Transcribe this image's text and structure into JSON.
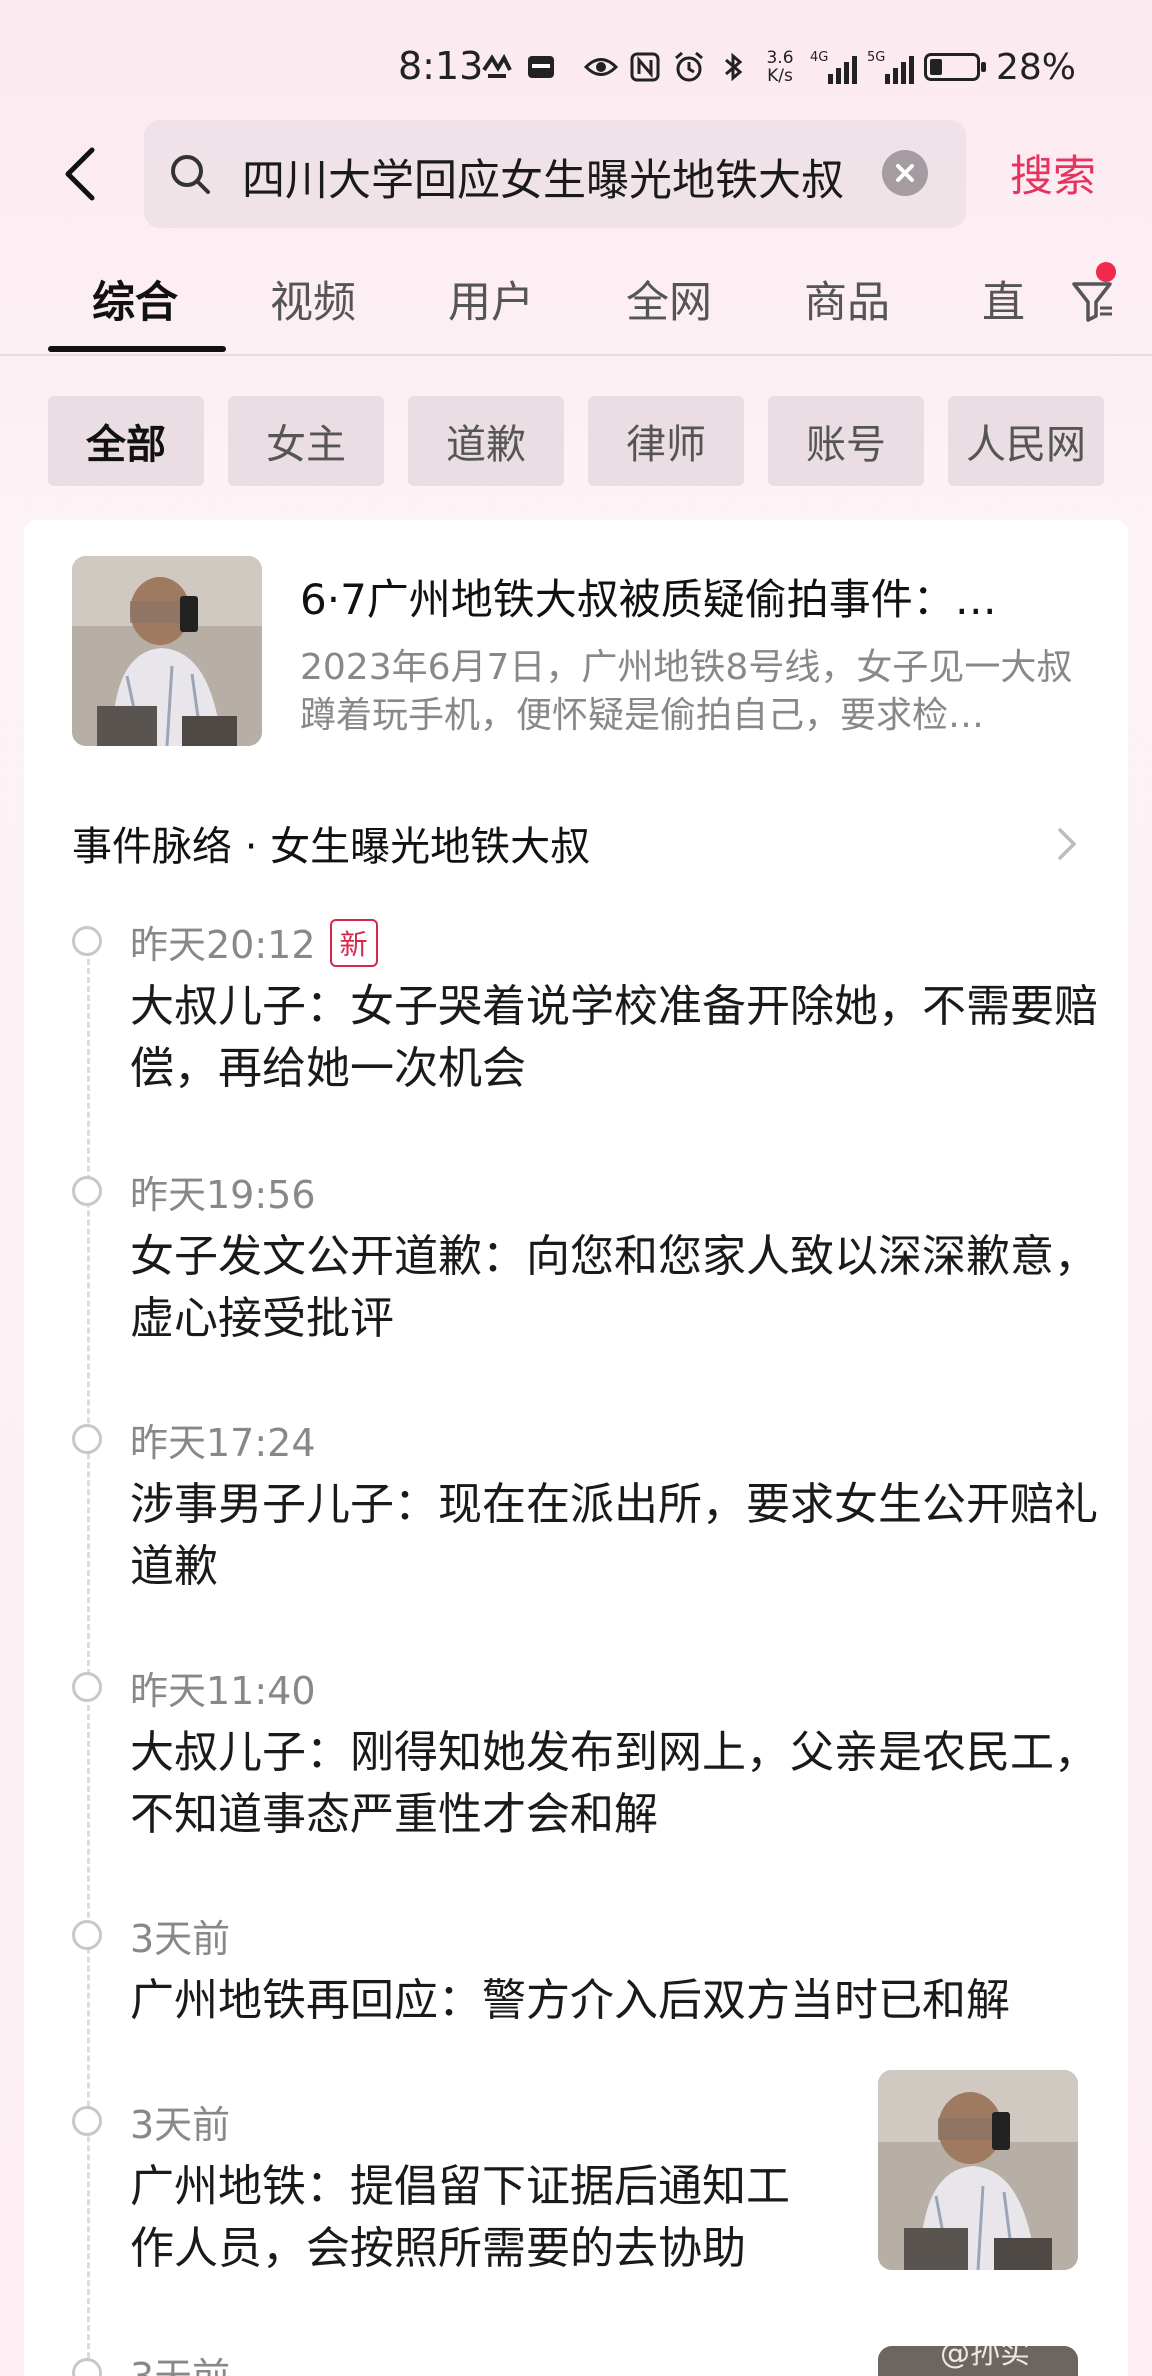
{
  "status_bar": {
    "time": "8:13",
    "network_speed_value": "3.6",
    "network_speed_unit": "K/s",
    "signal1_label": "4G",
    "signal2_label": "5G",
    "battery_percent": "28%",
    "battery_level": 0.28
  },
  "search": {
    "query": "四川大学回应女生曝光地铁大叔",
    "submit_label": "搜索"
  },
  "tabs": [
    "综合",
    "视频",
    "用户",
    "全网",
    "商品",
    "直"
  ],
  "chips": [
    "全部",
    "女主",
    "道歉",
    "律师",
    "账号",
    "人民网"
  ],
  "summary": {
    "title": "6·7广州地铁大叔被质疑偷拍事件：…",
    "description": "2023年6月7日，广州地铁8号线，女子见一大叔蹲着玩手机，便怀疑是偷拍自己，要求检…"
  },
  "timeline": {
    "header": "事件脉络 · 女生曝光地铁大叔",
    "new_badge": "新",
    "items": [
      {
        "time": "昨天20:12",
        "text": "大叔儿子：女子哭着说学校准备开除她，不需要赔偿，再给她一次机会"
      },
      {
        "time": "昨天19:56",
        "text": "女子发文公开道歉：向您和您家人致以深深歉意，虚心接受批评"
      },
      {
        "time": "昨天17:24",
        "text": "涉事男子儿子：现在在派出所，要求女生公开赔礼道歉"
      },
      {
        "time": "昨天11:40",
        "text": "大叔儿子：刚得知她发布到网上，父亲是农民工，不知道事态严重性才会和解"
      },
      {
        "time": "3天前",
        "text": "广州地铁再回应：警方介入后双方当时已和解"
      },
      {
        "time": "3天前",
        "text": "广州地铁：提倡留下证据后通知工作人员，会按照所需要的去协助"
      },
      {
        "time": "3天前",
        "text": ""
      }
    ]
  },
  "watermark": "@孙实"
}
